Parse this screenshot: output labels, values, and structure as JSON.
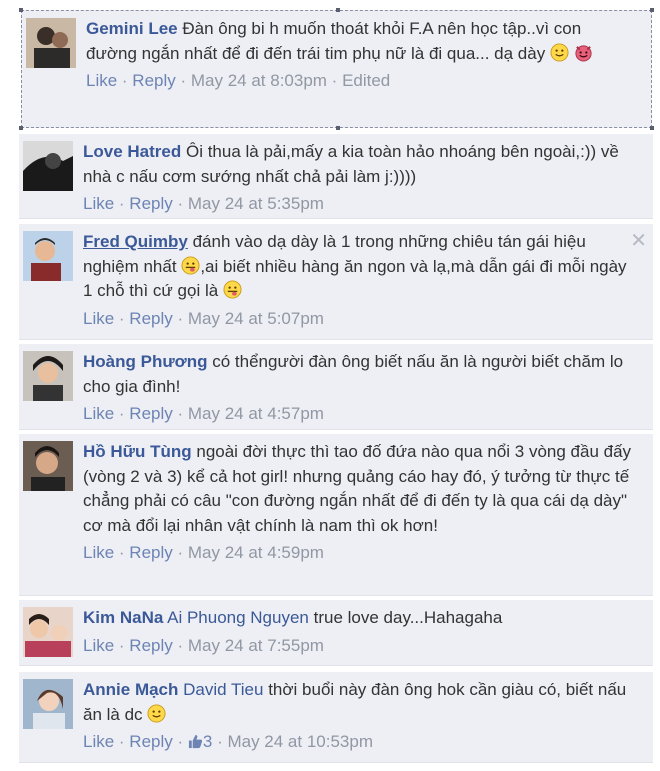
{
  "colors": {
    "name": "#3b5998",
    "link": "#6d84b4",
    "meta": "#9197a3",
    "text": "#333333",
    "background": "#edeff4"
  },
  "comments": [
    {
      "author": "Gemini Lee",
      "text": "Đàn ông bi h muốn thoát khỏi F.A nên học tập..vì con đường ngắn nhất để đi đến trái tim phụ nữ là đi qua... dạ dày",
      "emoticons": [
        "smile-emoticon",
        "devil-emoticon"
      ],
      "like": "Like",
      "reply": "Reply",
      "time": "May 24 at 8:03pm",
      "edited": "Edited"
    },
    {
      "author": "Love Hatred",
      "text": "Ôi thua là pải,mấy a kia toàn hảo nhoáng bên ngoài,:)) về nhà c nấu cơm sướng nhất chả pải làm j:))))",
      "like": "Like",
      "reply": "Reply",
      "time": "May 24 at 5:35pm"
    },
    {
      "author": "Fred Quimby",
      "text_part1": "đánh vào dạ dày là 1 trong những chiêu tán gái hiệu nghiệm nhất",
      "text_part2": ",ai biết nhiều hàng ăn ngon và lạ,mà dẫn gái đi mỗi ngày 1 chỗ thì cứ gọi là",
      "emoticons": [
        "tongue-emoticon",
        "tongue-emoticon"
      ],
      "close": "✕",
      "like": "Like",
      "reply": "Reply",
      "time": "May 24 at 5:07pm"
    },
    {
      "author": "Hoàng Phương",
      "text": "có thểngười đàn ông biết nấu ăn là người biết chăm lo cho gia đình!",
      "like": "Like",
      "reply": "Reply",
      "time": "May 24 at 4:57pm"
    },
    {
      "author": "Hồ Hữu Tùng",
      "text": "ngoài đời thực thì tao đố đứa nào qua nổi 3 vòng đầu đấy (vòng 2 và 3) kể cả hot girl! nhưng quảng cáo hay đó, ý tưởng từ thực tế chẳng phải có câu \"con đường ngắn nhất để đi đến ty là qua cái dạ dày\" cơ mà đổi lại nhân vật chính là nam thì ok hơn!",
      "like": "Like",
      "reply": "Reply",
      "time": "May 24 at 4:59pm"
    },
    {
      "author": "Kim NaNa",
      "mention": "Ai Phuong Nguyen",
      "text": "true love day...Hahagaha",
      "like": "Like",
      "reply": "Reply",
      "time": "May 24 at 7:55pm"
    },
    {
      "author": "Annie Mạch",
      "mention": "David Tieu",
      "text": "thời buổi này đàn ông hok cần giàu có, biết nấu ăn là dc",
      "emoticons": [
        "smile-emoticon"
      ],
      "like": "Like",
      "reply": "Reply",
      "likes_count": "3",
      "time": "May 24 at 10:53pm"
    }
  ]
}
